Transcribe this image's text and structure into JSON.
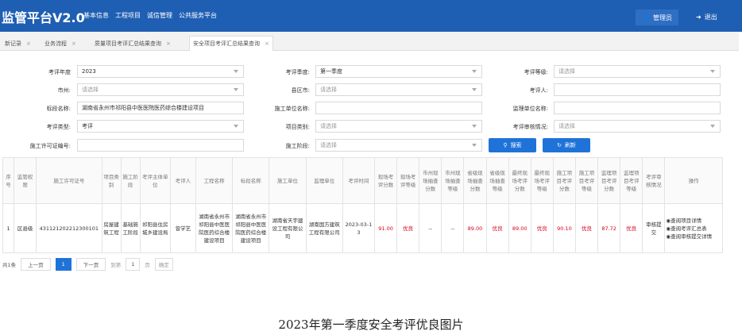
{
  "app": {
    "title": "监管平台V2.0",
    "nav": [
      "基本信息",
      "工程项目",
      "诚信管理",
      "公共服务平台"
    ],
    "admin_label": "管理员",
    "logout_label": "退出"
  },
  "tabs": [
    {
      "label": "新记录"
    },
    {
      "label": "业务流程"
    },
    {
      "label": "质量项目考评汇总结果查询"
    },
    {
      "label": "安全项目考评汇总结果查询",
      "active": true
    }
  ],
  "filters": {
    "eval_year_label": "考评年度",
    "eval_year_value": "2023",
    "eval_season_label": "考评季度:",
    "eval_season_value": "第一季度",
    "eval_grade_label": "考评等级:",
    "eval_grade_placeholder": "请选择",
    "city_label": "市州:",
    "city_placeholder": "请选择",
    "county_label": "县区市:",
    "county_placeholder": "请选择",
    "evaluator_label": "考评人:",
    "section_label": "标段名称:",
    "section_value": "湖南省永州市祁阳县中医医院医药综合楼建设项目",
    "construction_unit_label": "施工单位名称:",
    "supervision_unit_label": "监理单位名称:",
    "eval_type_label": "考评类型:",
    "eval_type_value": "考评",
    "project_category_label": "项目类别:",
    "project_category_placeholder": "请选择",
    "review_status_label": "考评审核情况:",
    "review_status_placeholder": "请选择",
    "permit_label": "施工许可证编号:",
    "stage_label": "施工阶段:",
    "stage_placeholder": "请选择",
    "search_label": "搜索",
    "refresh_label": "刷新"
  },
  "table": {
    "headers": [
      "序号",
      "监管权限",
      "施工许可证号",
      "项目类别",
      "施工阶段",
      "考评主体单位",
      "考评人",
      "工程名称",
      "标段名称",
      "施工单位",
      "监理单位",
      "考评时间",
      "现场考评分数",
      "现场考评等级",
      "市州现场抽查分数",
      "市州现场抽查等级",
      "省级现场抽查分数",
      "省级现场抽查等级",
      "最终现场考评分数",
      "最终现场考评等级",
      "施工项目考评分数",
      "施工项目考评等级",
      "监理项目考评分数",
      "监理项目考评等级",
      "考评审核情况",
      "操作"
    ],
    "rows": [
      {
        "cells": [
          "1",
          "区县级",
          "431121202212300101",
          "房屋建筑工程",
          "基础施工阶段",
          "祁阳县住房城乡建设局",
          "曾学艺",
          "湖南省永州市祁阳县中医医院医药综合楼建设项目",
          "湖南省永州市祁阳县中医医院医药综合楼建设项目",
          "湖南省天宇建设工程有限公司",
          "湖南国方建筑工程有限公司",
          "2023-03-13",
          "91.00",
          "优良",
          "--",
          "--",
          "89.00",
          "优良",
          "89.00",
          "优良",
          "90.10",
          "优良",
          "87.72",
          "优良",
          "审核提交"
        ],
        "ops": [
          "查阅项目详情",
          "查阅考评汇总表",
          "查阅审核提交详情"
        ]
      }
    ]
  },
  "pager": {
    "total": "共1条",
    "prev": "上一页",
    "current": "1",
    "next": "下一页",
    "goto": "到第",
    "page_value": "1",
    "page_unit": "页",
    "confirm": "确定"
  },
  "caption": "2023年第一季度安全考评优良图片"
}
